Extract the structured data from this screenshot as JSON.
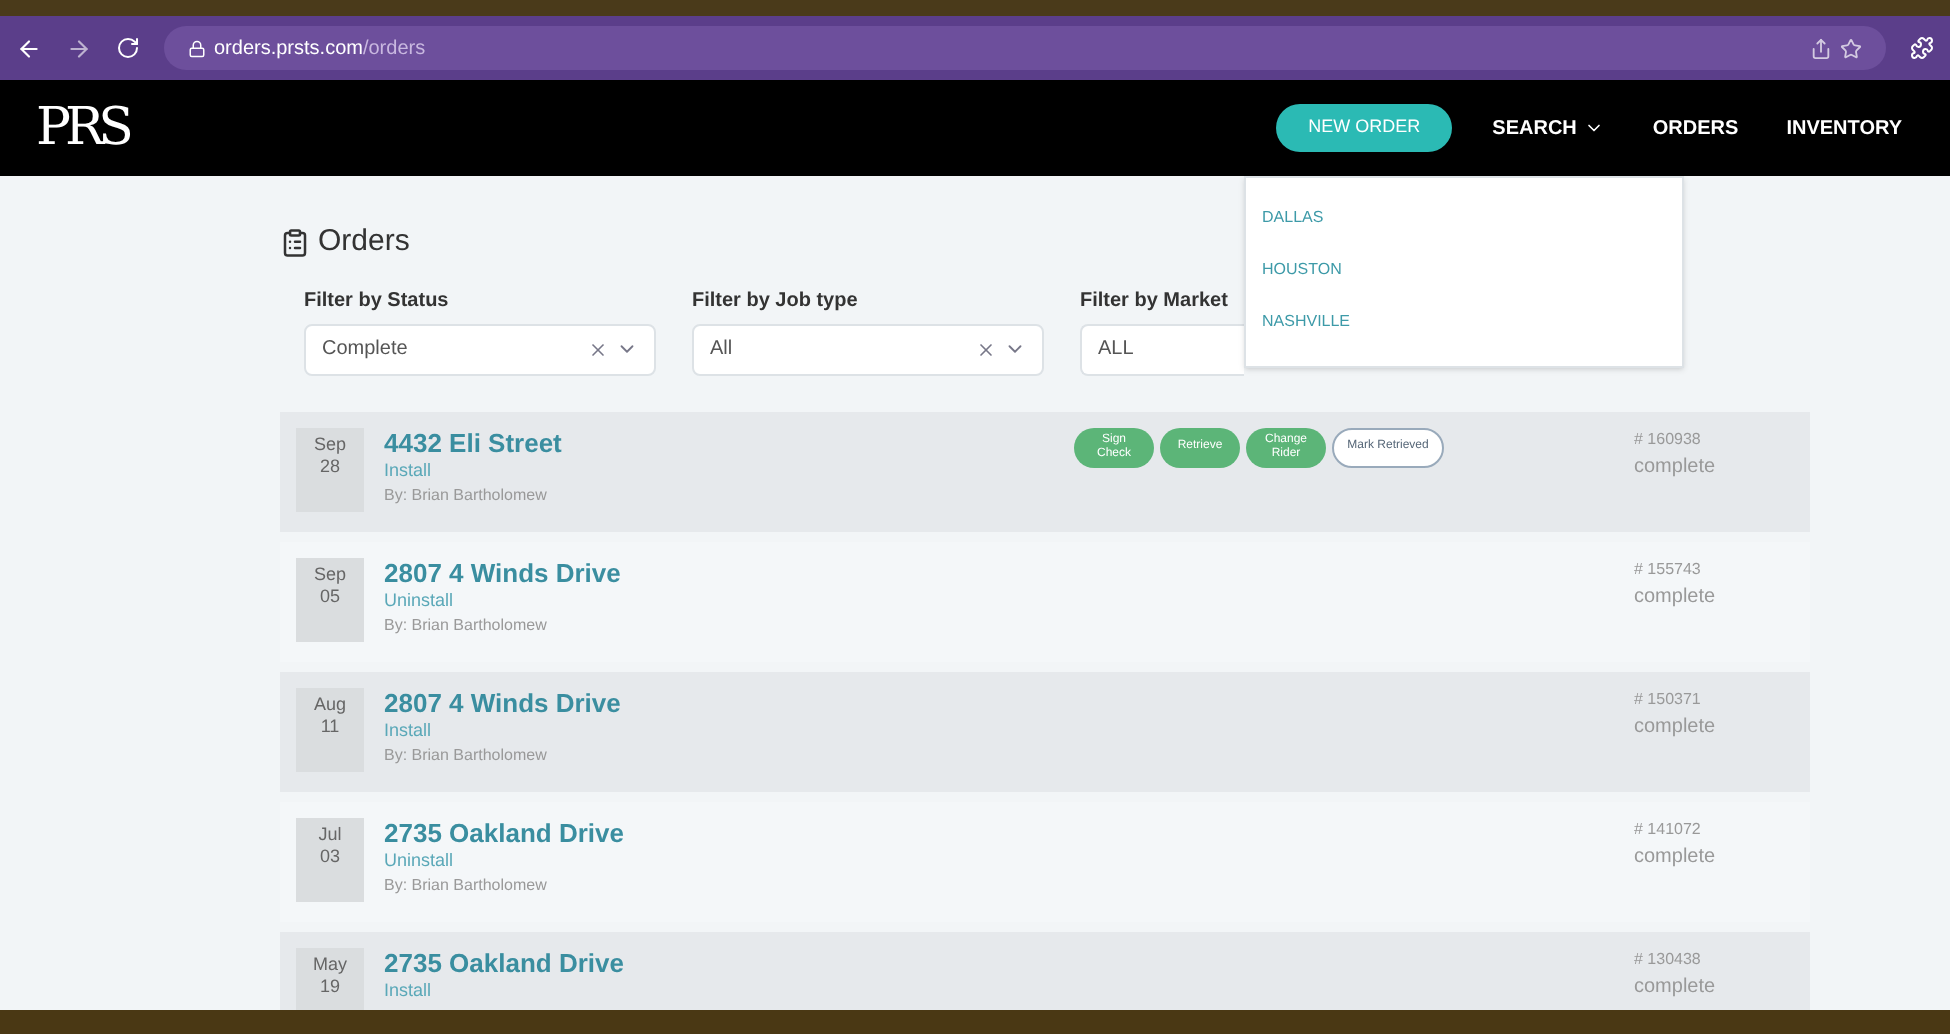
{
  "browser": {
    "url_host": "orders.prsts.com",
    "url_path": "/orders"
  },
  "nav": {
    "logo": "PRS",
    "new_order": "NEW ORDER",
    "items": [
      {
        "label": "SEARCH",
        "dropdown": true
      },
      {
        "label": "ORDERS",
        "dropdown": false
      },
      {
        "label": "INVENTORY",
        "dropdown": false
      }
    ]
  },
  "market_menu": [
    "DALLAS",
    "HOUSTON",
    "NASHVILLE"
  ],
  "page": {
    "title": "Orders"
  },
  "filters": [
    {
      "label": "Filter by Status",
      "value": "Complete",
      "clearable": true
    },
    {
      "label": "Filter by Job type",
      "value": "All",
      "clearable": true
    },
    {
      "label": "Filter by Market",
      "value": "ALL"
    }
  ],
  "orders": [
    {
      "month": "Sep",
      "day": "28",
      "address": "4432 Eli Street",
      "job": "Install",
      "by": "By: Brian Bartholomew",
      "number": "# 160938",
      "status": "complete",
      "actions": [
        {
          "label": "Sign Check",
          "kind": "filled"
        },
        {
          "label": "Retrieve",
          "kind": "filled"
        },
        {
          "label": "Change Rider",
          "kind": "filled"
        },
        {
          "label": "Mark Retrieved",
          "kind": "outline"
        }
      ]
    },
    {
      "month": "Sep",
      "day": "05",
      "address": "2807 4 Winds Drive",
      "job": "Uninstall",
      "by": "By: Brian Bartholomew",
      "number": "# 155743",
      "status": "complete"
    },
    {
      "month": "Aug",
      "day": "11",
      "address": "2807 4 Winds Drive",
      "job": "Install",
      "by": "By: Brian Bartholomew",
      "number": "# 150371",
      "status": "complete"
    },
    {
      "month": "Jul",
      "day": "03",
      "address": "2735 Oakland Drive",
      "job": "Uninstall",
      "by": "By: Brian Bartholomew",
      "number": "# 141072",
      "status": "complete"
    },
    {
      "month": "May",
      "day": "19",
      "address": "2735 Oakland Drive",
      "job": "Install",
      "number": "# 130438",
      "status": "complete"
    }
  ]
}
